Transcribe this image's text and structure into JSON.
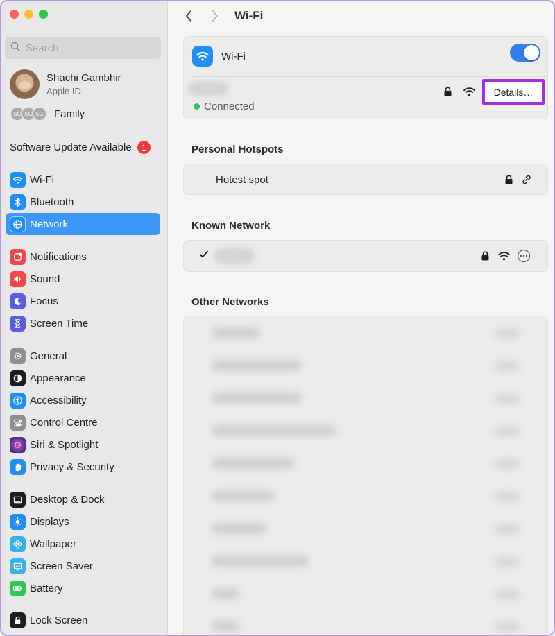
{
  "sidebar": {
    "search_placeholder": "Search",
    "user": {
      "name": "Shachi Gambhir",
      "subtitle": "Apple ID"
    },
    "family": {
      "avatars": [
        "SG",
        "SG",
        "SG"
      ],
      "label": "Family"
    },
    "update": {
      "label": "Software Update Available",
      "badge": "1"
    },
    "groups": [
      [
        {
          "label": "Wi-Fi",
          "icon": "wifi-icon",
          "color": "#1f8ef7"
        },
        {
          "label": "Bluetooth",
          "icon": "bluetooth-icon",
          "color": "#1f8ef7"
        },
        {
          "label": "Network",
          "icon": "globe-icon",
          "color": "#1f8ef7",
          "active": true
        }
      ],
      [
        {
          "label": "Notifications",
          "icon": "bell-icon",
          "color": "#f04848"
        },
        {
          "label": "Sound",
          "icon": "speaker-icon",
          "color": "#f04848"
        },
        {
          "label": "Focus",
          "icon": "moon-icon",
          "color": "#5c5ce0"
        },
        {
          "label": "Screen Time",
          "icon": "hourglass-icon",
          "color": "#5c5ce0"
        }
      ],
      [
        {
          "label": "General",
          "icon": "gear-icon",
          "color": "#8e8e93"
        },
        {
          "label": "Appearance",
          "icon": "appearance-icon",
          "color": "#1d1d1f"
        },
        {
          "label": "Accessibility",
          "icon": "accessibility-icon",
          "color": "#1f8ef7"
        },
        {
          "label": "Control Centre",
          "icon": "toggles-icon",
          "color": "#8e8e93"
        },
        {
          "label": "Siri & Spotlight",
          "icon": "siri-icon",
          "color": "#5a3a9e"
        },
        {
          "label": "Privacy & Security",
          "icon": "hand-icon",
          "color": "#1f8ef7"
        }
      ],
      [
        {
          "label": "Desktop & Dock",
          "icon": "dock-icon",
          "color": "#1d1d1f"
        },
        {
          "label": "Displays",
          "icon": "sun-icon",
          "color": "#1f8ef7"
        },
        {
          "label": "Wallpaper",
          "icon": "flower-icon",
          "color": "#3ab0e8"
        },
        {
          "label": "Screen Saver",
          "icon": "screensaver-icon",
          "color": "#3ab0e8"
        },
        {
          "label": "Battery",
          "icon": "battery-icon",
          "color": "#32c553"
        }
      ],
      [
        {
          "label": "Lock Screen",
          "icon": "lock-screen-icon",
          "color": "#1d1d1f"
        }
      ]
    ]
  },
  "main": {
    "title": "Wi-Fi",
    "wifi": {
      "label": "Wi-Fi",
      "enabled": true,
      "status": "Connected",
      "details_label": "Details…"
    },
    "personal_hotspots": {
      "heading": "Personal Hotspots",
      "name": "Hotest spot"
    },
    "known_network": {
      "heading": "Known Network"
    },
    "other_networks": {
      "heading": "Other Networks"
    }
  },
  "colors": {
    "accent": "#3d96f9",
    "toggle_on": "#2f80ed",
    "highlight": "#a62fe6",
    "badge": "#ec3b3b",
    "connected": "#31c553"
  }
}
